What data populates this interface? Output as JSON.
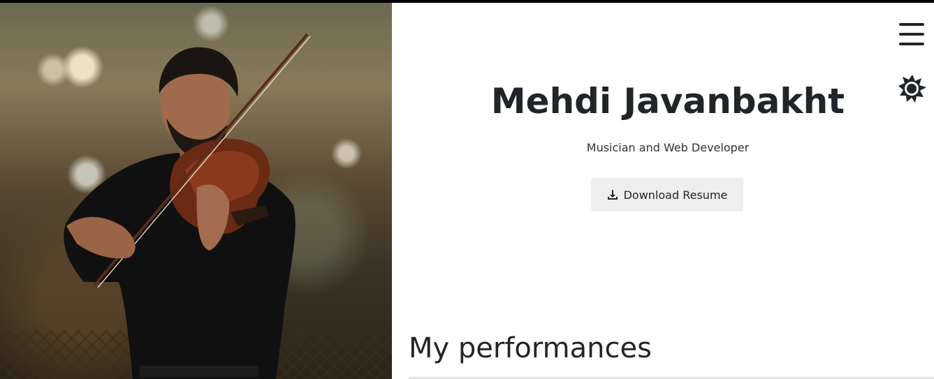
{
  "hero": {
    "name": "Mehdi Javanbakht",
    "tagline": "Musician and Web Developer",
    "download_button": {
      "label": "Download Resume",
      "icon": "download-icon"
    },
    "photo": {
      "subject": "violinist performing"
    }
  },
  "nav": {
    "menu_icon": "hamburger-menu-icon",
    "theme_icon": "sun-theme-toggle-icon"
  },
  "sections": [
    {
      "title": "My performances"
    }
  ],
  "colors": {
    "text": "#212529",
    "button_bg": "#eeeeee",
    "top_border": "#000000"
  }
}
